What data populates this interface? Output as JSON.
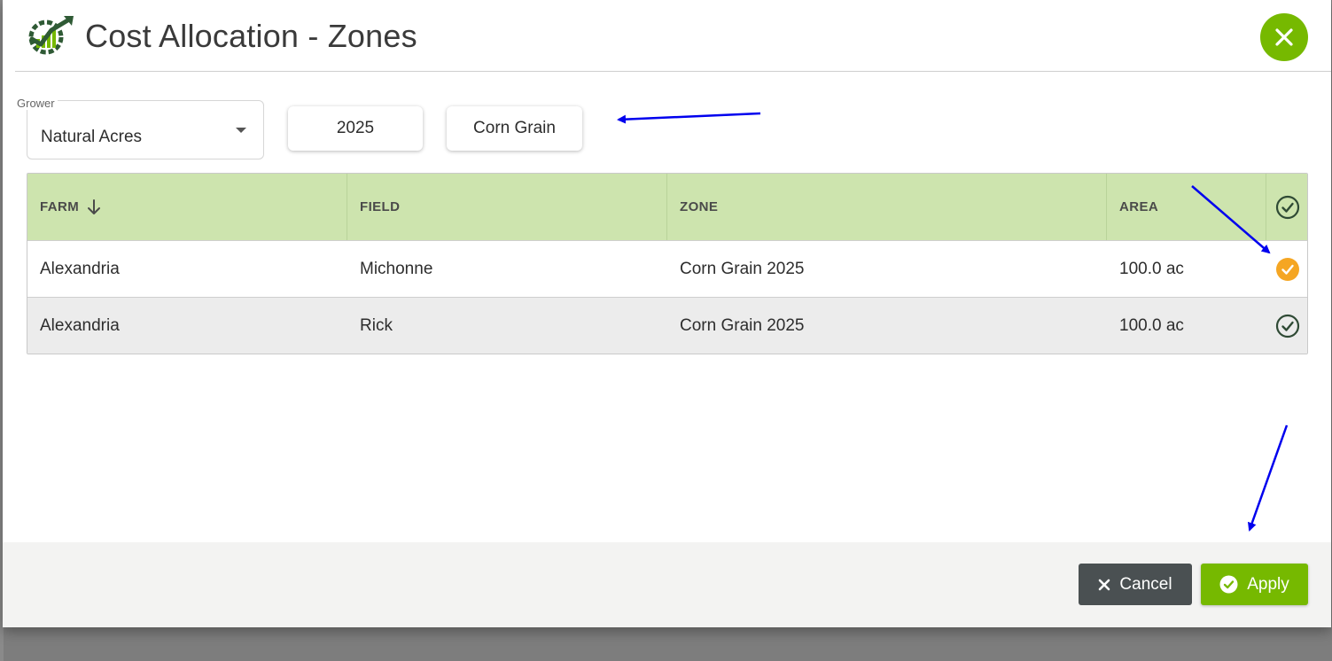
{
  "dialog": {
    "title": "Cost Allocation - Zones",
    "logo_icon": "gear-chart-logo-icon",
    "close_icon": "close-icon",
    "accent_color": "#76b900"
  },
  "filters": {
    "grower": {
      "label": "Grower",
      "value": "Natural Acres"
    },
    "year": "2025",
    "crop": "Corn Grain"
  },
  "table": {
    "headers": {
      "farm": "FARM",
      "field": "FIELD",
      "zone": "ZONE",
      "area": "AREA",
      "farm_sort_icon": "arrow-down-icon",
      "select_icon": "check-circle-icon"
    },
    "header_color": "#cde4ae",
    "rows": [
      {
        "farm": "Alexandria",
        "field": "Michonne",
        "zone": "Corn Grain 2025",
        "area": "100.0 ac",
        "status": "selected",
        "status_color": "#f5a623"
      },
      {
        "farm": "Alexandria",
        "field": "Rick",
        "zone": "Corn Grain 2025",
        "area": "100.0 ac",
        "status": "check",
        "status_color": "#2f4a35"
      }
    ]
  },
  "footer": {
    "cancel_label": "Cancel",
    "apply_label": "Apply",
    "cancel_icon": "x-icon",
    "apply_icon": "check-circle-icon"
  },
  "annotations": {
    "arrow_color": "#0000ee"
  }
}
